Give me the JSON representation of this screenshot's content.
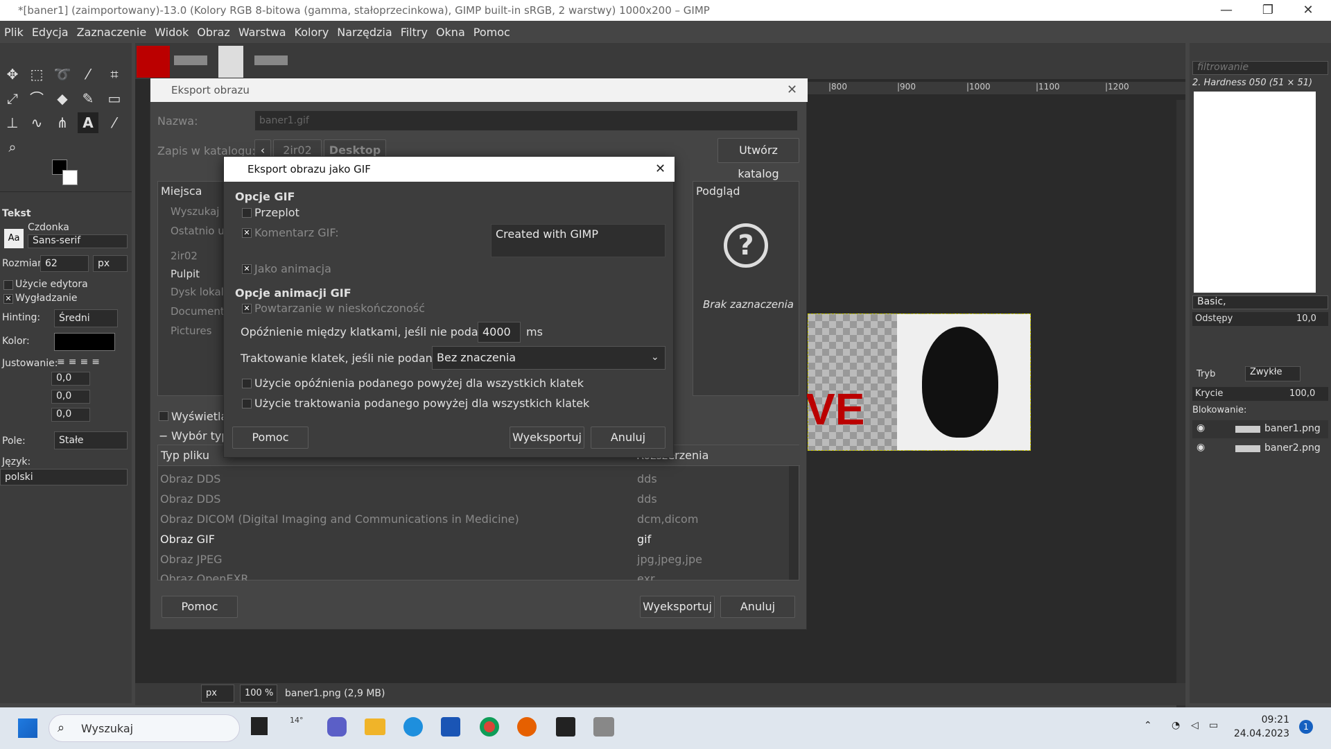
{
  "window": {
    "title": "*[baner1] (zaimportowany)-13.0 (Kolory RGB 8-bitowa (gamma, stałoprzecinkowa), GIMP built-in sRGB, 2 warstwy) 1000x200 – GIMP",
    "min": "—",
    "max": "❐",
    "close": "✕"
  },
  "menu": [
    "Plik",
    "Edycja",
    "Zaznaczenie",
    "Widok",
    "Obraz",
    "Warstwa",
    "Kolory",
    "Narzędzia",
    "Filtry",
    "Okna",
    "Pomoc"
  ],
  "toolOptions": {
    "title": "Tekst",
    "font_label": "Czdonka",
    "font_value": "Sans-serif",
    "font_btn": "Aa",
    "size_label": "Rozmiar:",
    "size_value": "62",
    "size_unit": "px",
    "use_editor": "Użycie edytora",
    "antialias": "Wygładzanie",
    "hinting_label": "Hinting:",
    "hinting_value": "Średni",
    "color_label": "Kolor:",
    "justify_label": "Justowanie:",
    "indent1": "0,0",
    "indent2": "0,0",
    "indent3": "0,0",
    "box_label": "Pole:",
    "box_value": "Stałe",
    "lang_label": "Język:",
    "lang_value": "polski"
  },
  "rightPanel": {
    "filter_placeholder": "filtrowanie",
    "brush_name": "2. Hardness 050 (51 × 51)",
    "preset": "Basic,",
    "spacing_label": "Odstępy",
    "spacing_value": "10,0",
    "mode_label": "Tryb",
    "mode_value": "Zwykłe",
    "opacity_label": "Krycie",
    "opacity_value": "100,0",
    "lock_label": "Blokowanie:",
    "layers": [
      "baner1.png",
      "baner2.png"
    ]
  },
  "ruler": [
    "|800",
    "|900",
    "|1000",
    "|1100",
    "|1200"
  ],
  "canvas": {
    "text_fragment": "VE"
  },
  "status": {
    "unit": "px",
    "zoom": "100 %",
    "file": "baner1.png (2,9 MB)"
  },
  "exportDialog": {
    "title": "Eksport obrazu",
    "name_label": "Nazwa:",
    "name_value": "baner1.gif",
    "save_in_label": "Zapis w katalogu:",
    "path": [
      "2ir02",
      "Desktop"
    ],
    "create_folder": "Utwórz katalog",
    "places_header": "Miejsca",
    "places": [
      "Wyszukaj",
      "Ostatnio u",
      "2ir02",
      "Pulpit",
      "Dysk lokal",
      "Document",
      "Pictures"
    ],
    "preview_header": "Podgląd",
    "no_selection": "Brak zaznaczenia",
    "show_all": "Wyświetla",
    "file_type_sel": "Wybór typ",
    "col_type": "Typ pliku",
    "col_ext": "Rozszerzenia",
    "filetypes": [
      {
        "name": "Obraz DDS",
        "ext": "dds"
      },
      {
        "name": "Obraz DDS",
        "ext": "dds"
      },
      {
        "name": "Obraz DICOM (Digital Imaging and Communications in Medicine)",
        "ext": "dcm,dicom"
      },
      {
        "name": "Obraz GIF",
        "ext": "gif"
      },
      {
        "name": "Obraz JPEG",
        "ext": "jpg,jpeg,jpe"
      },
      {
        "name": "Obraz OpenEXR",
        "ext": "exr"
      }
    ],
    "help": "Pomoc",
    "export": "Wyeksportuj",
    "cancel": "Anuluj"
  },
  "gifDialog": {
    "title": "Eksport obrazu jako GIF",
    "section1": "Opcje GIF",
    "interlace": "Przeplot",
    "comment_label": "Komentarz GIF:",
    "comment_value": "Created with GIMP",
    "as_animation": "Jako animacja",
    "section2": "Opcje animacji GIF",
    "loop": "Powtarzanie w nieskończoność",
    "delay_label": "Opóźnienie między klatkami, jeśli nie podano:",
    "delay_value": "4000",
    "delay_unit": "ms",
    "disposal_label": "Traktowanie klatek, jeśli nie podano:",
    "disposal_value": "Bez znaczenia",
    "use_delay_all": "Użycie opóźnienia podanego powyżej dla wszystkich klatek",
    "use_disposal_all": "Użycie traktowania podanego powyżej dla wszystkich klatek",
    "help": "Pomoc",
    "export": "Wyeksportuj",
    "cancel": "Anuluj"
  },
  "taskbar": {
    "search": "Wyszukaj",
    "weather": "14°",
    "time": "09:21",
    "date": "24.04.2023",
    "notif": "1"
  }
}
